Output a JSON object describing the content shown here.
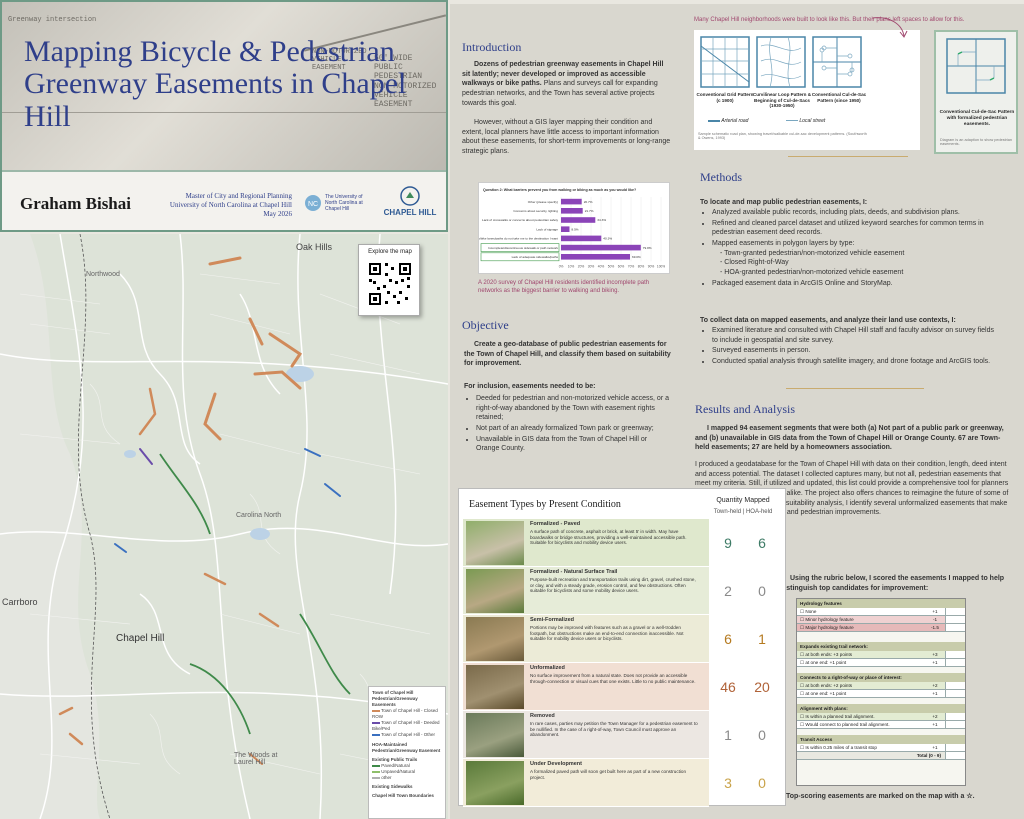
{
  "title": {
    "main": "Mapping Bicycle & Pedestrian Greenway Easements in Chapel Hill",
    "author": "Graham Bishai",
    "degree_lines": [
      "Master of City and Regional Planning",
      "University of North Carolina at Chapel Hill",
      "May 2026"
    ],
    "unc_logo_text": "The University of North Carolina at Chapel Hill",
    "town_logo_text": "CHAPEL HILL",
    "plat_text_1": "Greenway intersection",
    "plat_text_2": "NON-MOTORIZED VEHICLE EASEMENT",
    "plat_text_3": "50' WIDE PUBLIC PEDESTRIAN NON-MOTORIZED VEHICLE EASEMENT"
  },
  "map": {
    "qr_label": "Explore the map",
    "towns": [
      "Oak Hills",
      "Northwood",
      "Carrboro",
      "Chapel Hill",
      "Carolina North",
      "The Woods at Laurel Hill"
    ],
    "legend_title": "Town of Chapel Hill Pedestrian/Greenway Easements",
    "legend_items": [
      "Town of Chapel Hill - Closed ROW",
      "Town of Chapel Hill - Deeded Bike/Ped",
      "Town of Chapel Hill - Other",
      "HOA-Maintained Pedestrian/Greenway Easement",
      "Existing Public Trails",
      "Paved/Natural",
      "Unpaved/Natural",
      "other",
      "Existing Sidewalks",
      "Chapel Hill Town Boundaries"
    ]
  },
  "introduction": {
    "heading": "Introduction",
    "p1_bold": "Dozens of pedestrian greenway easements in Chapel Hill sit latently; never developed or improved as accessible walkways or bike paths.",
    "p1_rest": " Plans and surveys call for expanding pedestrian networks, and the Town has several active projects towards this goal.",
    "p2": "However, without a GIS layer mapping their condition and extent, local planners have little access to important information about these easements, for short-term improvements or long-range strategic plans."
  },
  "survey_chart": {
    "title": "Question 2: What barriers prevent you from walking or biking as much as you would like?",
    "caption": "A 2020 survey of Chapel Hill residents identified incomplete path networks as the biggest barrier to walking and biking.",
    "chart_data": {
      "type": "bar",
      "orientation": "horizontal",
      "title": "Question 2: What barriers prevent you from walking or biking as much as you would like?",
      "categories": [
        "Other (please specify)",
        "Concerns about security, lighting",
        "Lack of crosswalks or concerns about pedestrian safety",
        "Lack of signage",
        "Existing sidewalks/bike lanes/paths do not take me to the destination I want",
        "Incomplete/discontinuous sidewalk or path network",
        "Lack of adequate sidewalks/paths"
      ],
      "values": [
        20.7,
        21.7,
        34.3,
        8.5,
        40.3,
        79.8,
        69.0
      ],
      "value_labels": [
        "20.7%",
        "21.7%",
        "34.3%",
        "8.5%",
        "40.3%",
        "79.8%",
        "69.0%"
      ],
      "x_ticks": [
        "0%",
        "10%",
        "20%",
        "30%",
        "40%",
        "50%",
        "60%",
        "70%",
        "80%",
        "90%",
        "100%"
      ],
      "xlim": [
        0,
        100
      ],
      "highlighted": [
        "Incomplete/discontinuous sidewalk or path network",
        "Lack of adequate sidewalks/paths"
      ],
      "color": "#8b44b8"
    }
  },
  "objective": {
    "heading": "Objective",
    "p1_bold": "Create a geo-database of public pedestrian easements for the Town of Chapel Hill, and classify them based on suitability for improvement.",
    "criteria_heading": "For inclusion, easements needed to be:",
    "criteria": [
      "Deeded for pedestrian and non-motorized vehicle access, or a right-of-way abandoned by the Town with easement rights retained;",
      "Not part of an already formalized Town park or greenway;",
      "Unavailable in GIS data from the Town of Chapel Hill or Orange County."
    ]
  },
  "neighborhoods": {
    "caption": "Many Chapel Hill neighborhoods were built to look like this. But their plans left spaces to allow for this.",
    "patterns": [
      "Conventional Grid Pattern (c 1900)",
      "Curvilinear Loop Pattern & Beginning of Cul-de-Sacs (1930-1950)",
      "Conventional Cul-de-Sac Pattern (since 1950)"
    ],
    "legend": [
      "Arterial road",
      "Local street"
    ],
    "source_note": "Sample schematic road plan, showing travel/walkable cul-de-sac development patterns. (Southworth & Owens, 1993)",
    "inset_title": "Conventional Cul-de-Sac Pattern with formalized pedestrian easements.",
    "inset_note": "Diagram is an adaption to show pedestrian easements."
  },
  "methods": {
    "heading": "Methods",
    "group1_heading": "To locate and map public pedestrian easements, I:",
    "group1": [
      "Analyzed available public records, including plats, deeds, and subdivision plans.",
      "Refined and cleaned parcel dataset and utilized keyword searches for common terms in pedestrian easement deed records.",
      "Mapped easements in polygon layers by type:"
    ],
    "types": [
      "- Town-granted pedestrian/non-motorized vehicle easement",
      "- Closed Right-of-Way",
      "- HOA-granted pedestrian/non-motorized vehicle easement"
    ],
    "group1_last": "Packaged easement data in ArcGIS Online and StoryMap.",
    "group2_heading": "To collect data on mapped easements, and analyze their land use contexts, I:",
    "group2": [
      "Examined literature and consulted with Chapel Hill staff and faculty advisor on survey fields to include in geospatial and site survey.",
      "Surveyed easements in person.",
      "Conducted spatial analysis through satellite imagery, and drone footage and ArcGIS tools."
    ]
  },
  "results": {
    "heading": "Results and Analysis",
    "p1_bold": "I mapped 94 easement segments that were both (a) Not part of a public park or greenway, and (b) unavailable in GIS data from the Town of Chapel Hill or Orange County. 67 are Town-held easements; 27 are held by a homeowners association.",
    "p2": "I produced a geodatabase for the Town of Chapel Hill with data on their condition, length, deed intent and access potential. The dataset I collected captures many, but not all, pedestrian easements that meet my criteria. Still, if utilized and updated, this list could provide a comprehensive tool for planners and the Chapel Hill residents alike. The project also offers chances to reimagine the future of some of these easements. Through a suitability analysis, I identify several unformalized easements that make worthy candidates for bicycle and pedestrian improvements.",
    "rubric_intro": "Using the rubric below, I scored the easements I mapped to help distinguish top candidates for improvement:",
    "footer": "Top-scoring easements are marked on the map with a ☆."
  },
  "easement_types": {
    "heading": "Easement Types by Present Condition",
    "qty_heading": "Quantity Mapped",
    "col_town": "Town-held",
    "col_hoa": "HOA-held",
    "rows": [
      {
        "name": "Formalized - Paved",
        "desc": "A surface path of concrete, asphalt or brick, at least 5' in width. May have boardwalks or bridge structures, providing a well-maintained accessible path. Suitable for bicyclists and mobility device users.",
        "town": "9",
        "hoa": "6",
        "bg": "#dfe8cd",
        "color": "#3e7b66"
      },
      {
        "name": "Formalized - Natural Surface Trail",
        "desc": "Purpose-built recreation and transportation trails using dirt, gravel, crushed stone, or clay, and with a steady grade, erosion control, and few obstructions. Often suitable for bicyclists and some mobility device users.",
        "town": "2",
        "hoa": "0",
        "bg": "#e6ecd8",
        "color": "#8a8a8a"
      },
      {
        "name": "Semi-Formalized",
        "desc": "Portions may be improved with features such as a gravel or a well-trodden footpath, but obstructions make an end-to-end connection inaccessible. Not suitable for mobility device users or bicyclists.",
        "town": "6",
        "hoa": "1",
        "bg": "#ecebd7",
        "color": "#b57a20"
      },
      {
        "name": "Unformalized",
        "desc": "No surface improvement from a natural state. Does not provide an accessible through-connection or visual cues that one exists. Little to no public maintenance.",
        "town": "46",
        "hoa": "20",
        "bg": "#f1dfd3",
        "color": "#b06238"
      },
      {
        "name": "Removed",
        "desc": "In rare cases, parties may petition the Town Manager for a pedestrian easement to be nullified. In the case of a right-of-way, Town Council must approve an abandonment.",
        "town": "1",
        "hoa": "0",
        "bg": "#ece7e2",
        "color": "#8a8a8a"
      },
      {
        "name": "Under Development",
        "desc": "A formalized paved path will soon get built here as part of a new construction project.",
        "town": "3",
        "hoa": "0",
        "bg": "#f2ecd9",
        "color": "#c9a34a"
      }
    ]
  },
  "rubric": {
    "sections": [
      {
        "title": "Hydrology features",
        "items": [
          {
            "label": "None",
            "pts": "+1",
            "color": "#ffffff"
          },
          {
            "label": "Minor hydrology feature",
            "pts": "-1",
            "color": "#efd1d1"
          },
          {
            "label": "Major hydrology feature",
            "pts": "-1.5",
            "color": "#e6b9b9"
          }
        ]
      },
      {
        "title": "Expands existing trail network:",
        "items": [
          {
            "label": "at both ends: +3 points",
            "pts": "+3",
            "color": "#e3ecd3"
          },
          {
            "label": "at one end: +1 point",
            "pts": "+1",
            "color": "#ffffff"
          }
        ]
      },
      {
        "title": "Connects to a right-of-way or place of interest:",
        "items": [
          {
            "label": "at both ends: +2 points",
            "pts": "+2",
            "color": "#e3ecd3"
          },
          {
            "label": "at one end: +1 point",
            "pts": "+1",
            "color": "#ffffff"
          }
        ]
      },
      {
        "title": "Alignment with plans:",
        "items": [
          {
            "label": "Is within a planned trail alignment.",
            "pts": "+2",
            "color": "#e3ecd3"
          },
          {
            "label": "Would connect to planned trail alignment.",
            "pts": "+1",
            "color": "#ffffff"
          }
        ]
      },
      {
        "title": "Transit Access",
        "items": [
          {
            "label": "Is within 0.25 miles of a transit stop",
            "pts": "+1",
            "color": "#ffffff"
          }
        ]
      }
    ],
    "total_label": "Total (0 - 9)"
  }
}
